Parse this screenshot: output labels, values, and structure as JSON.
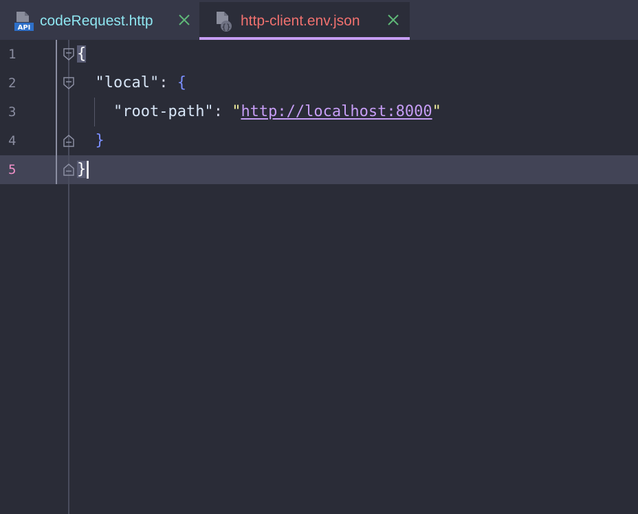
{
  "tabs": [
    {
      "label": "codeRequest.http",
      "icon": "api-file-icon",
      "active": false
    },
    {
      "label": "http-client.env.json",
      "icon": "json-env-file-icon",
      "active": true
    }
  ],
  "editor": {
    "current_line": 5,
    "lines": [
      {
        "number": "1",
        "open_brace": "{"
      },
      {
        "number": "2",
        "indent": "  ",
        "key": "\"local\"",
        "colon": ": ",
        "brace": "{"
      },
      {
        "number": "3",
        "indent": "    ",
        "key": "\"root-path\"",
        "colon": ": ",
        "quote_open": "\"",
        "url": "http://localhost:8000",
        "quote_close": "\""
      },
      {
        "number": "4",
        "indent": "  ",
        "brace": "}"
      },
      {
        "number": "5",
        "close_brace": "}"
      }
    ]
  },
  "colors": {
    "background": "#2a2c37",
    "tab_active_underline": "#c69df5",
    "tab_inactive_label": "#8ee5f0",
    "tab_active_label": "#f0716f",
    "url": "#c69df5",
    "brace": "#7b8fff",
    "current_line_number": "#f090c8"
  }
}
